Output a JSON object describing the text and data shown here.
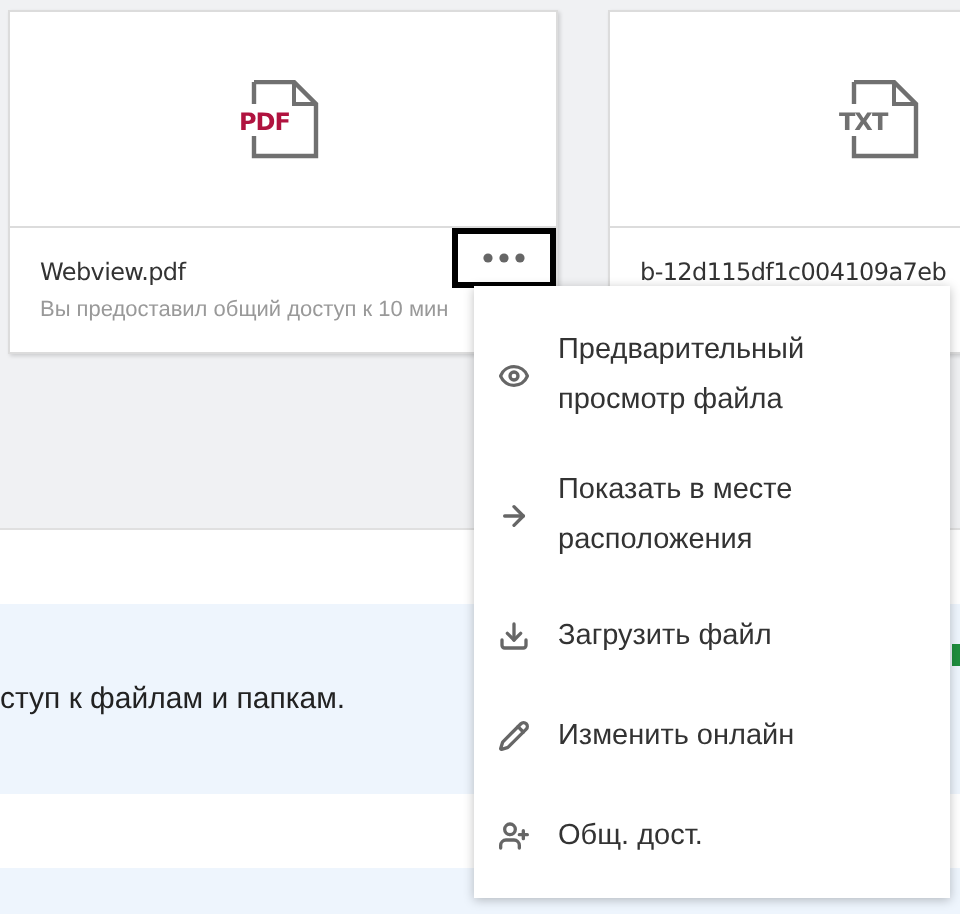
{
  "files": [
    {
      "name": "Webview.pdf",
      "file_label": "PDF",
      "color": "#b0133f",
      "subtitle": "Вы предоставил общий доступ к 10 мин",
      "more_button": {
        "focused": true
      }
    },
    {
      "name": "b-12d115df1c004109a7eb",
      "file_label": "TXT",
      "color": "#707070"
    }
  ],
  "rows": [
    {
      "text": "",
      "highlighted": false
    },
    {
      "text": "ступ к файлам и папкам.",
      "highlighted": true
    },
    {
      "text": "",
      "highlighted": false
    },
    {
      "text": "",
      "highlighted": true
    }
  ],
  "context_menu": {
    "items": [
      {
        "label": "Предварительный просмотр файла"
      },
      {
        "label": "Показать в месте расположения"
      },
      {
        "label": "Загрузить файл"
      },
      {
        "label": "Изменить онлайн"
      },
      {
        "label": "Общ. дост."
      }
    ]
  }
}
